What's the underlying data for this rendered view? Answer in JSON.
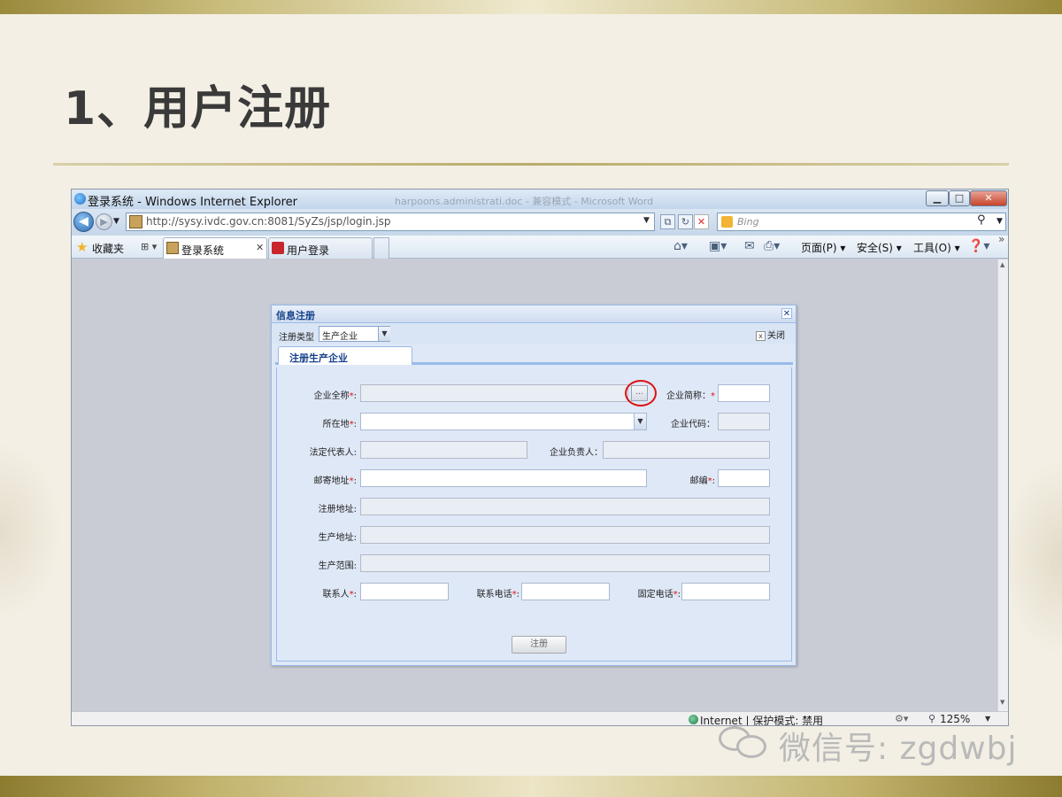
{
  "slide": {
    "title": "1、用户注册",
    "watermark": "微信号: zgdwbj"
  },
  "browser": {
    "window_title": "登录系统 - Windows Internet Explorer",
    "ghost_title": "harpoons.administrati.doc - 兼容模式 - Microsoft Word",
    "url": "http://sysy.ivdc.gov.cn:8081/SyZs/jsp/login.jsp",
    "search_placeholder": "Bing",
    "favorites_label": "收藏夹",
    "tabs": [
      {
        "label": "登录系统",
        "active": true
      },
      {
        "label": "用户登录",
        "active": false
      }
    ],
    "commands": {
      "page": "页面(P)",
      "safety": "安全(S)",
      "tools": "工具(O)"
    },
    "status": "Internet | 保护模式: 禁用",
    "zoom": "125%"
  },
  "dialog": {
    "title": "信息注册",
    "type_label": "注册类型",
    "type_value": "生产企业",
    "close_label": "关闭",
    "tab_label": "注册生产企业",
    "fields": {
      "full_name": "企业全称",
      "short_name": "企业简称：",
      "location": "所在地",
      "company_code": "企业代码：",
      "legal_rep": "法定代表人:",
      "person_in_charge": "企业负责人：",
      "mail_address": "邮寄地址",
      "postcode": "邮编",
      "reg_address": "注册地址:",
      "prod_address": "生产地址:",
      "prod_scope": "生产范围:",
      "contact": "联系人",
      "contact_phone": "联系电话",
      "fixed_phone": "固定电话"
    },
    "required_mark": "*",
    "ellipsis": "...",
    "submit_label": "注册"
  },
  "colors": {
    "dialog_header_text": "#15428b",
    "dialog_border": "#99bbe8",
    "required": "#e01010",
    "annotation_circle": "#d11111"
  },
  "icons": [
    "ie-logo-icon",
    "back-icon",
    "forward-icon",
    "refresh-icon",
    "stop-icon",
    "search-icon",
    "star-icon",
    "home-icon",
    "rss-icon",
    "mail-icon",
    "print-icon",
    "help-icon",
    "globe-icon",
    "zoom-icon",
    "close-icon",
    "dropdown-arrow-icon",
    "wechat-icon"
  ]
}
